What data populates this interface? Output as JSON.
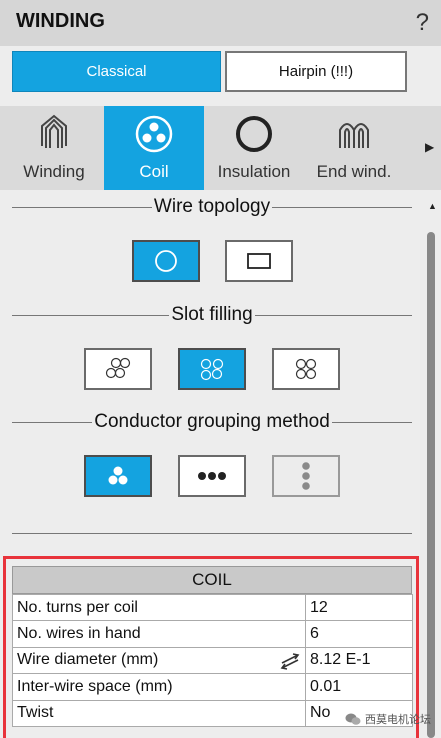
{
  "header": {
    "title": "WINDING",
    "help_label": "?"
  },
  "mode_buttons": [
    {
      "label": "Classical",
      "selected": true
    },
    {
      "label": "Hairpin (!!!)",
      "selected": false
    }
  ],
  "tabs": [
    {
      "label": "Winding",
      "icon": "winding-icon",
      "active": false
    },
    {
      "label": "Coil",
      "icon": "coil-icon",
      "active": true
    },
    {
      "label": "Insulation",
      "icon": "insulation-ring-icon",
      "active": false
    },
    {
      "label": "End wind.",
      "icon": "end-winding-icon",
      "active": false
    }
  ],
  "sections": {
    "wire_topology": {
      "label": "Wire topology",
      "options": [
        "round-wire-icon",
        "rectangular-wire-icon"
      ],
      "selected_index": 0
    },
    "slot_filling": {
      "label": "Slot filling",
      "options": [
        "slot-fill-a-icon",
        "slot-fill-b-icon",
        "slot-fill-c-icon"
      ],
      "selected_index": 1
    },
    "conductor_grouping": {
      "label": "Conductor grouping method",
      "options": [
        "group-cluster-icon",
        "group-row-icon",
        "group-column-icon"
      ],
      "selected_index": 0,
      "disabled_index": 2
    }
  },
  "coil": {
    "title": "COIL",
    "rows": [
      {
        "label": "No. turns per coil",
        "value": "12"
      },
      {
        "label": "No. wires in hand",
        "value": "6"
      },
      {
        "label": "Wire diameter (mm)",
        "value": "8.12 E-1"
      },
      {
        "label": "Inter-wire space (mm)",
        "value": "0.01"
      },
      {
        "label": "Twist",
        "value": "No"
      }
    ]
  },
  "watermark": "西莫电机论坛",
  "colors": {
    "accent": "#14a3e0",
    "highlight_border": "#e8333b"
  }
}
